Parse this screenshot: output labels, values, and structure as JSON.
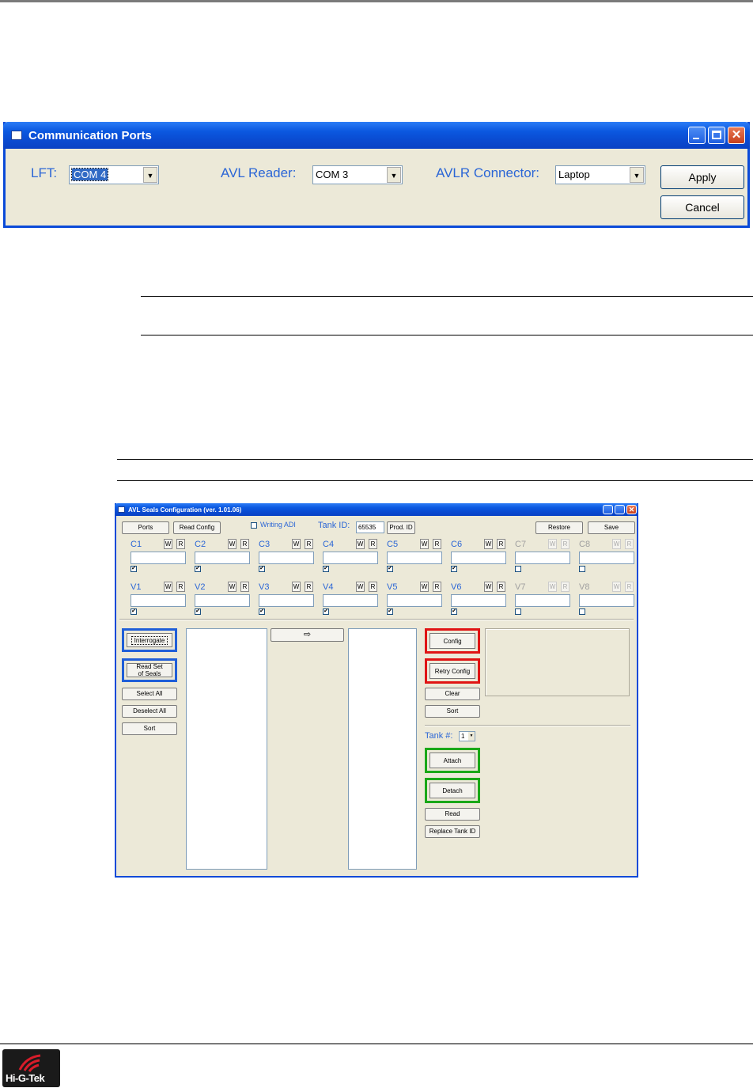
{
  "comm_ports": {
    "title": "Communication Ports",
    "lft_label": "LFT:",
    "lft_value": "COM 4",
    "avl_reader_label": "AVL Reader:",
    "avl_reader_value": "COM 3",
    "avlr_connector_label": "AVLR Connector:",
    "avlr_connector_value": "Laptop",
    "apply_label": "Apply",
    "cancel_label": "Cancel"
  },
  "seals": {
    "title": "AVL Seals Configuration (ver. 1.01.06)",
    "toolbar": {
      "ports": "Ports",
      "read_config": "Read Config",
      "writing_adi": "Writing ADI",
      "tank_id_label": "Tank ID:",
      "tank_id_value": "65535",
      "prod_id": "Prod. ID",
      "restore": "Restore",
      "save": "Save"
    },
    "w_label": "W",
    "r_label": "R",
    "channels_c": [
      "C1",
      "C2",
      "C3",
      "C4",
      "C5",
      "C6",
      "C7",
      "C8"
    ],
    "channels_v": [
      "V1",
      "V2",
      "V3",
      "V4",
      "V5",
      "V6",
      "V7",
      "V8"
    ],
    "checked_mark": "✔",
    "left_buttons": {
      "interrogate": "Interrogate",
      "read_set": "Read Set of Seals",
      "select_all": "Select All",
      "deselect_all": "Deselect All",
      "sort": "Sort"
    },
    "move_arrow": "⇨",
    "right_buttons": {
      "config": "Config",
      "retry_config": "Retry Config",
      "clear": "Clear",
      "sort": "Sort",
      "tank_label": "Tank #:",
      "tank_value": "1",
      "attach": "Attach",
      "detach": "Detach",
      "read": "Read",
      "replace_tank_id": "Replace Tank ID"
    }
  },
  "footer": {
    "logo_text": "Hi-G-Tek"
  }
}
